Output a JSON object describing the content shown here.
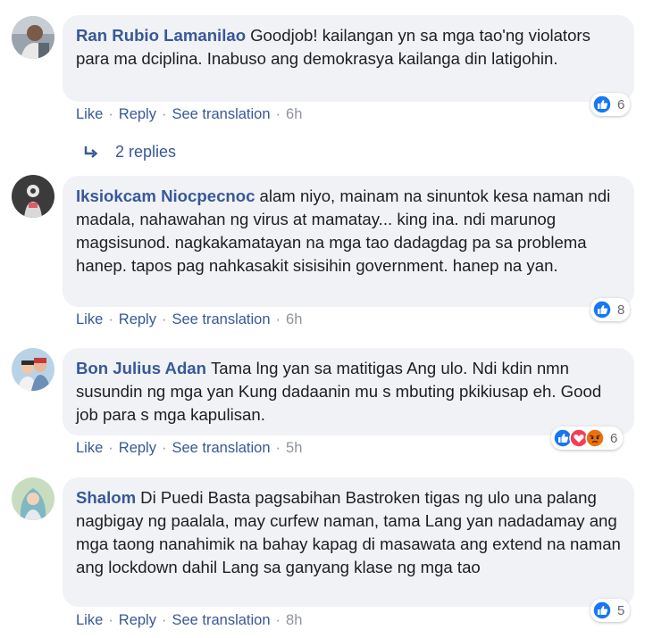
{
  "comments": [
    {
      "author": "Ran Rubio Lamanilao",
      "text": "Goodjob! kailangan yn sa mga tao'ng violators para ma dciplina. Inabuso ang demokrasya kailanga din latigohin.",
      "reaction_count": "6",
      "reactions": [
        "like"
      ],
      "actions": {
        "like": "Like",
        "reply": "Reply",
        "translate": "See translation",
        "time": "6h"
      }
    },
    {
      "author": "Iksiokcam Niocpecnoc",
      "text": "alam niyo, mainam na sinuntok kesa naman ndi madala, nahawahan ng virus at mamatay... king ina. ndi marunog magsisunod. nagkakamatayan na mga tao dadagdag pa sa problema hanep. tapos pag nahkasakit sisisihin government. hanep na yan.",
      "reaction_count": "8",
      "reactions": [
        "like"
      ],
      "actions": {
        "like": "Like",
        "reply": "Reply",
        "translate": "See translation",
        "time": "6h"
      }
    },
    {
      "author": "Bon Julius Adan",
      "text": "Tama lng yan sa matitigas Ang ulo. Ndi kdin nmn susundin ng mga yan Kung dadaanin mu s mbuting pkikiusap eh. Good job para s mga kapulisan.",
      "reaction_count": "6",
      "reactions": [
        "like",
        "love",
        "angry"
      ],
      "actions": {
        "like": "Like",
        "reply": "Reply",
        "translate": "See translation",
        "time": "5h"
      }
    },
    {
      "author": "Shalom",
      "text": "Di Puedi Basta pagsabihan Bastroken tigas ng ulo una palang nagbigay ng paalala, may curfew naman, tama Lang yan nadadamay ang mga taong nanahimik na bahay kapag di masawata ang extend na naman ang lockdown dahil Lang sa ganyang klase ng mga tao",
      "reaction_count": "5",
      "reactions": [
        "like"
      ],
      "actions": {
        "like": "Like",
        "reply": "Reply",
        "translate": "See translation",
        "time": "8h"
      }
    }
  ],
  "replies_link": "2 replies",
  "colors": {
    "link": "#385898",
    "bubble": "#f0f2f5",
    "like": "#1877f2",
    "love": "#f33e58",
    "angry": "#e9710f"
  },
  "icons": [
    "reply-arrow-icon",
    "like-reaction-icon",
    "love-reaction-icon",
    "angry-reaction-icon"
  ]
}
